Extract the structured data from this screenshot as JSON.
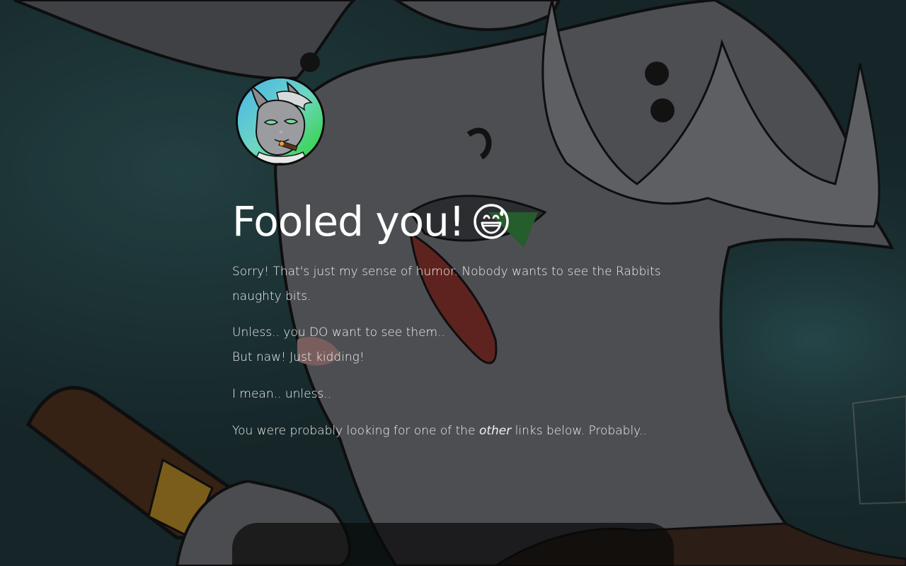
{
  "profile": {
    "avatar_icon": "rabbit-avatar-icon"
  },
  "heading": {
    "text": "Fooled you!",
    "emoji_icon": "grinning-sweat-emoji-icon"
  },
  "paragraphs": {
    "p1": "Sorry! That's just my sense of humor. Nobody wants to see the Rabbits naughty bits.",
    "p2_line1": "Unless.. you DO want to see them..",
    "p2_line2": "But naw! Just kidding!",
    "p3": "I mean.. unless..",
    "p4_before": "You were probably looking for one of the ",
    "p4_emph": "other",
    "p4_after": " links below. Probably.."
  },
  "colors": {
    "background": "#1d3a3d",
    "text": "#f4f4f4",
    "panel": "#0a0a0a"
  }
}
